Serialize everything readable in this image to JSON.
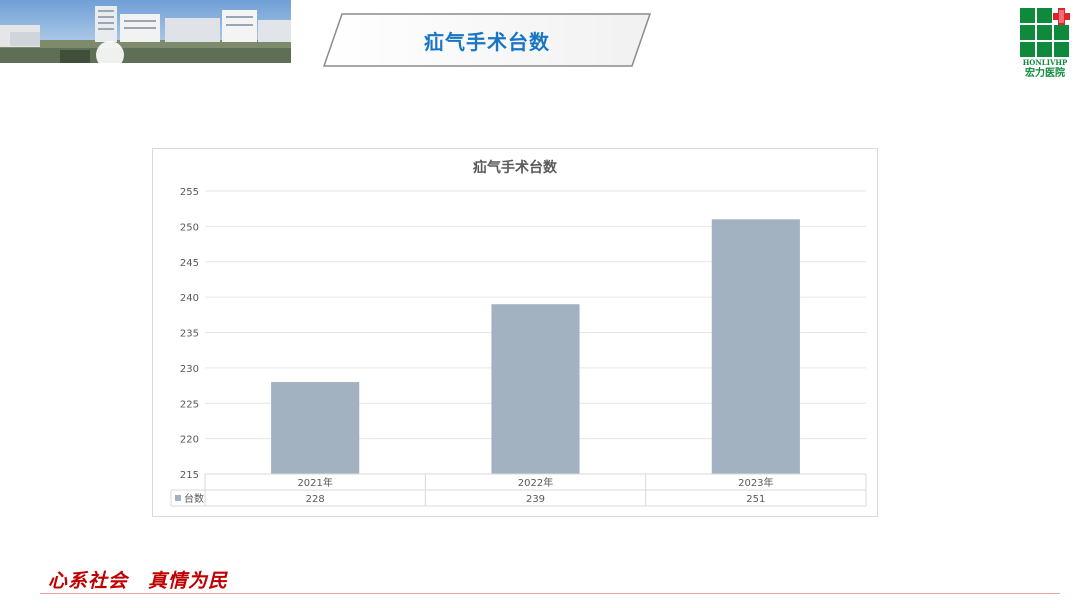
{
  "header": {
    "title": "疝气手术台数",
    "logo_text_en": "HONLIVHP",
    "logo_text_cn": "宏力医院"
  },
  "footer": {
    "slogan": "心系社会　真情为民"
  },
  "colors": {
    "title_blue": "#1976c5",
    "bar": "#a3b2c1",
    "logo_green": "#0f8a3c",
    "logo_red": "#e0242b",
    "slogan_red": "#c00000"
  },
  "chart_data": {
    "type": "bar",
    "title": "疝气手术台数",
    "categories": [
      "2021年",
      "2022年",
      "2023年"
    ],
    "series": [
      {
        "name": "台数",
        "values": [
          228,
          239,
          251
        ]
      }
    ],
    "ylim": [
      215,
      255
    ],
    "yticks": [
      215,
      220,
      225,
      230,
      235,
      240,
      245,
      250,
      255
    ],
    "grid": true,
    "data_table": true
  }
}
